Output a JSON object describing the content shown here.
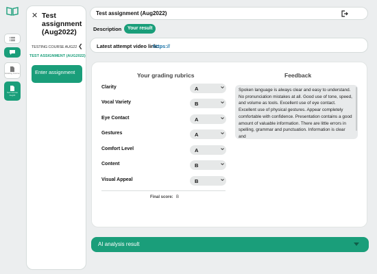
{
  "rail": {
    "items": [
      {
        "name": "list-view",
        "caption": ""
      },
      {
        "name": "chat",
        "caption": ""
      },
      {
        "name": "course-list",
        "caption": "Existing Course"
      },
      {
        "name": "course-active",
        "caption": "Test Course Aug22"
      }
    ]
  },
  "course_panel": {
    "title": "Test assignment (Aug2022)",
    "course_name": "TESTING COURSE AUG22",
    "assignment_link": "TEST ASSIGNMENT (AUG2022)",
    "enter_button": "Enter assignment"
  },
  "header": {
    "title": "Test assignment (Aug2022)"
  },
  "tabs": {
    "description": "Description",
    "result": "Your result"
  },
  "video": {
    "label": "Latest attempt video link:",
    "link": "https://"
  },
  "rubrics": {
    "heading": "Your grading rubrics",
    "items": [
      {
        "label": "Clarity",
        "grade": "A"
      },
      {
        "label": "Vocal Variety",
        "grade": "B"
      },
      {
        "label": "Eye Contact",
        "grade": "A"
      },
      {
        "label": "Gestures",
        "grade": "A"
      },
      {
        "label": "Comfort Level",
        "grade": "A"
      },
      {
        "label": "Content",
        "grade": "B"
      },
      {
        "label": "Visual Appeal",
        "grade": "B"
      }
    ],
    "final_label": "Final score:",
    "final_value": "B"
  },
  "feedback": {
    "heading": "Feedback",
    "text": "Spoken language is always clear and easy to understand. No pronunciation mistakes at all. Good use of tone, speed, and volume as tools. Excellent use of eye contact. Excellent use of physical gestures. Appear completely comfortable with confidence. Presentation contains a good amount of valuable information. There are little errors in spelling, grammar and punctuation. Information is clear and"
  },
  "ai_analysis": {
    "label": "AI analysis result"
  },
  "colors": {
    "accent": "#1a9e7a",
    "link": "#1a73a8"
  }
}
